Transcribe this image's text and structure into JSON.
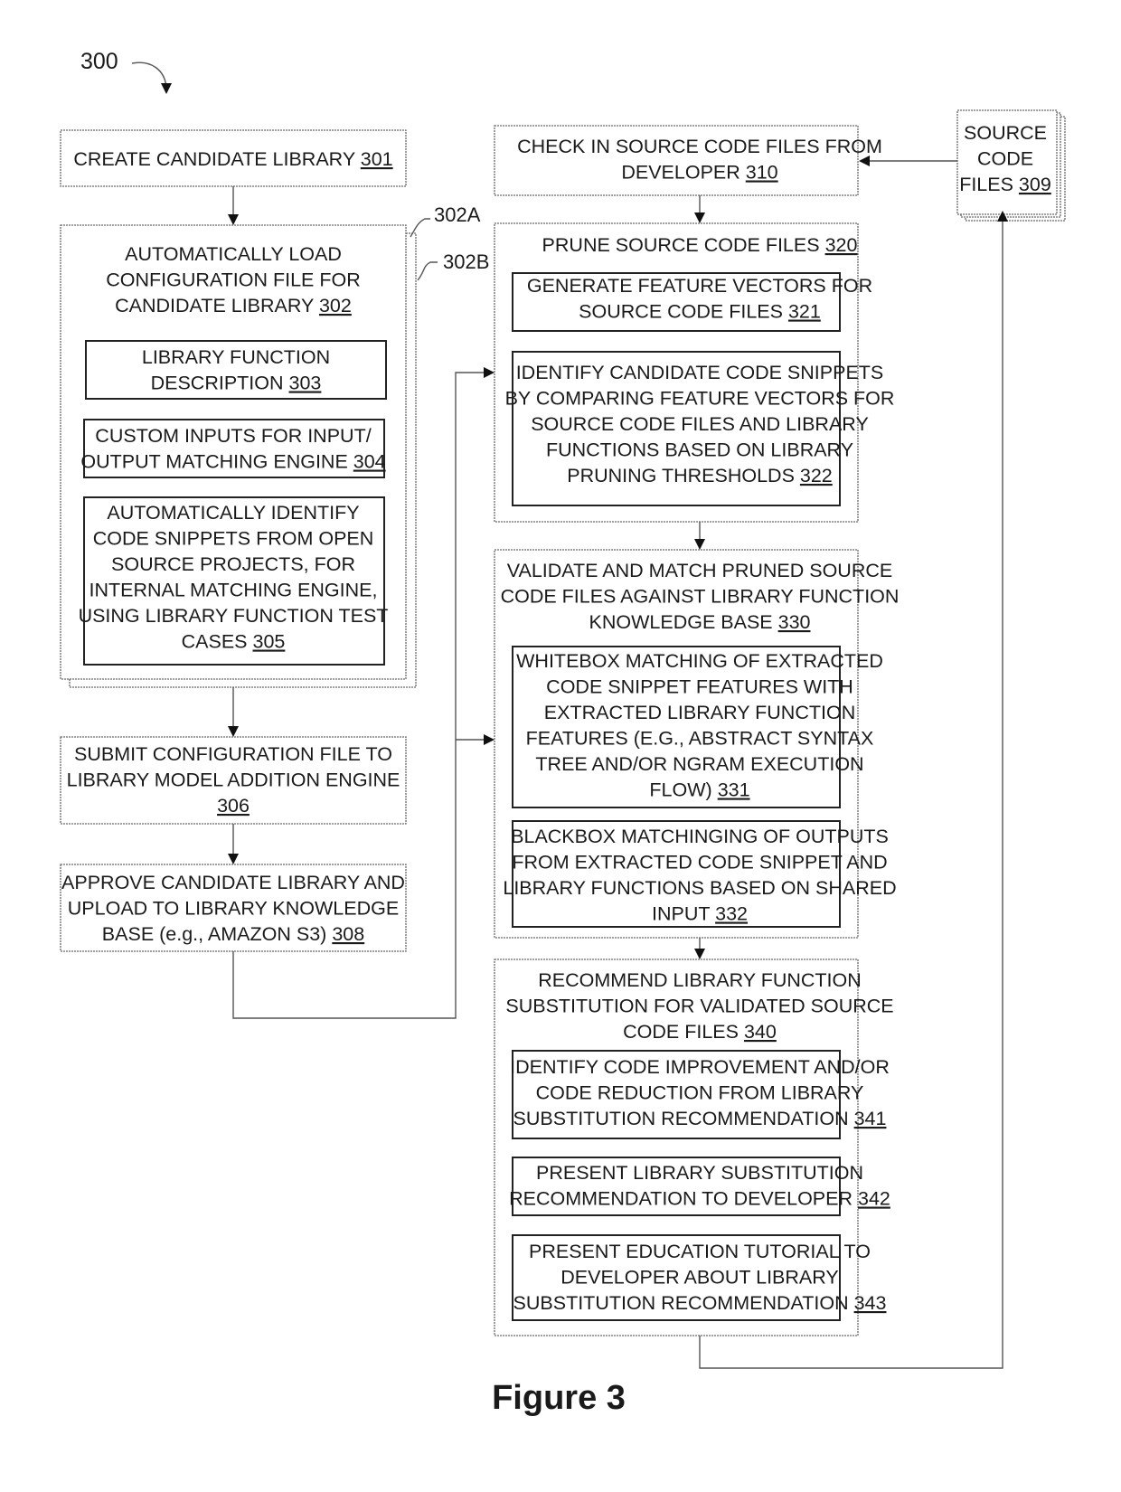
{
  "figure": {
    "number": "300",
    "caption": "Figure 3"
  },
  "callouts": {
    "a": "302A",
    "b": "302B"
  },
  "boxes": {
    "b301": {
      "lines": [
        "CREATE CANDIDATE LIBRARY"
      ],
      "ref": "301"
    },
    "b302": {
      "lines": [
        "AUTOMATICALLY LOAD",
        "CONFIGURATION FILE FOR",
        "CANDIDATE LIBRARY"
      ],
      "ref": "302"
    },
    "b303": {
      "lines": [
        "LIBRARY FUNCTION",
        "DESCRIPTION"
      ],
      "ref": "303"
    },
    "b304": {
      "lines": [
        "CUSTOM INPUTS FOR INPUT/",
        "OUTPUT MATCHING ENGINE"
      ],
      "ref": "304"
    },
    "b305": {
      "lines": [
        "AUTOMATICALLY IDENTIFY",
        "CODE SNIPPETS FROM OPEN",
        "SOURCE PROJECTS, FOR",
        "INTERNAL MATCHING ENGINE,",
        "USING LIBRARY FUNCTION TEST",
        "CASES"
      ],
      "ref": "305"
    },
    "b306": {
      "lines": [
        "SUBMIT CONFIGURATION FILE TO",
        "LIBRARY MODEL ADDITION ENGINE",
        ""
      ],
      "ref": "306"
    },
    "b308": {
      "lines": [
        "APPROVE CANDIDATE LIBRARY AND",
        "UPLOAD TO LIBRARY KNOWLEDGE",
        "BASE (e.g., AMAZON S3)"
      ],
      "ref": "308"
    },
    "b309": {
      "lines": [
        "SOURCE",
        "CODE",
        "FILES"
      ],
      "ref": "309"
    },
    "b310": {
      "lines": [
        "CHECK IN SOURCE CODE FILES FROM",
        "DEVELOPER"
      ],
      "ref": "310"
    },
    "b320": {
      "lines": [
        "PRUNE SOURCE CODE FILES"
      ],
      "ref": "320"
    },
    "b321": {
      "lines": [
        "GENERATE FEATURE VECTORS FOR",
        "SOURCE CODE FILES"
      ],
      "ref": "321"
    },
    "b322": {
      "lines": [
        "IDENTIFY CANDIDATE CODE SNIPPETS",
        "BY COMPARING FEATURE VECTORS FOR",
        "SOURCE CODE FILES AND LIBRARY",
        "FUNCTIONS BASED ON LIBRARY",
        "PRUNING THRESHOLDS"
      ],
      "ref": "322"
    },
    "b330": {
      "lines": [
        "VALIDATE AND MATCH PRUNED SOURCE",
        "CODE FILES AGAINST LIBRARY FUNCTION",
        "KNOWLEDGE BASE"
      ],
      "ref": "330"
    },
    "b331": {
      "lines": [
        "WHITEBOX MATCHING OF EXTRACTED",
        "CODE SNIPPET FEATURES WITH",
        "EXTRACTED LIBRARY FUNCTION",
        "FEATURES (E.G., ABSTRACT SYNTAX",
        "TREE AND/OR NGRAM EXECUTION",
        "FLOW)"
      ],
      "ref": "331"
    },
    "b332": {
      "lines": [
        "BLACKBOX MATCHINGING OF OUTPUTS",
        "FROM EXTRACTED CODE SNIPPET AND",
        "LIBRARY FUNCTIONS BASED ON SHARED",
        "INPUT"
      ],
      "ref": "332"
    },
    "b340": {
      "lines": [
        "RECOMMEND LIBRARY FUNCTION",
        "SUBSTITUTION FOR VALIDATED SOURCE",
        "CODE FILES"
      ],
      "ref": "340"
    },
    "b341": {
      "lines": [
        "IDENTIFY CODE IMPROVEMENT AND/OR",
        "CODE REDUCTION FROM LIBRARY",
        "SUBSTITUTION RECOMMENDATION"
      ],
      "ref": "341"
    },
    "b342": {
      "lines": [
        "PRESENT LIBRARY SUBSTITUTION",
        "RECOMMENDATION TO DEVELOPER"
      ],
      "ref": "342"
    },
    "b343": {
      "lines": [
        "PRESENT EDUCATION TUTORIAL TO",
        "DEVELOPER ABOUT LIBRARY",
        "SUBSTITUTION RECOMMENDATION"
      ],
      "ref": "343"
    }
  },
  "connections": [
    {
      "from": "301",
      "to": "302"
    },
    {
      "from": "302",
      "to": "306"
    },
    {
      "from": "306",
      "to": "308"
    },
    {
      "from": "308",
      "to": "322"
    },
    {
      "from": "308",
      "to": "330"
    },
    {
      "from": "309",
      "to": "310"
    },
    {
      "from": "310",
      "to": "320"
    },
    {
      "from": "320",
      "to": "330"
    },
    {
      "from": "330",
      "to": "340"
    },
    {
      "from": "340",
      "to": "309"
    }
  ]
}
